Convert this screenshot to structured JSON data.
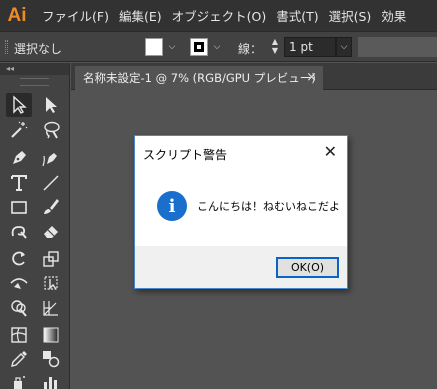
{
  "app": {
    "logo_text": "Ai",
    "accent": "#f08a24"
  },
  "menu": [
    "ファイル(F)",
    "編集(E)",
    "オブジェクト(O)",
    "書式(T)",
    "選択(S)",
    "効果"
  ],
  "control_bar": {
    "selection_label": "選択なし",
    "fill_color": "#ffffff",
    "stroke_label": "線：",
    "stroke_weight": "1 pt"
  },
  "tools_panel": {
    "collapse_glyph": "◂◂",
    "tools": [
      "selection-tool",
      "direct-selection-tool",
      "magic-wand-tool",
      "lasso-tool",
      "pen-tool",
      "curvature-tool",
      "type-tool",
      "line-segment-tool",
      "rectangle-tool",
      "paintbrush-tool",
      "shaper-tool",
      "eraser-tool",
      "rotate-tool",
      "scale-tool",
      "width-tool",
      "free-transform-tool",
      "shape-builder-tool",
      "perspective-grid-tool",
      "mesh-tool",
      "gradient-tool",
      "eyedropper-tool",
      "blend-tool",
      "symbol-sprayer-tool",
      "column-graph-tool"
    ]
  },
  "document_tab": {
    "title": "名称未設定-1 @ 7% (RGB/GPU プレビュー)",
    "close_glyph": "×"
  },
  "dialog": {
    "title": "スクリプト警告",
    "close_glyph": "✕",
    "icon_glyph": "i",
    "message": "こんにちは！ねむいねこだよ",
    "ok_label": "OK(O)",
    "accent": "#0a64c8"
  }
}
